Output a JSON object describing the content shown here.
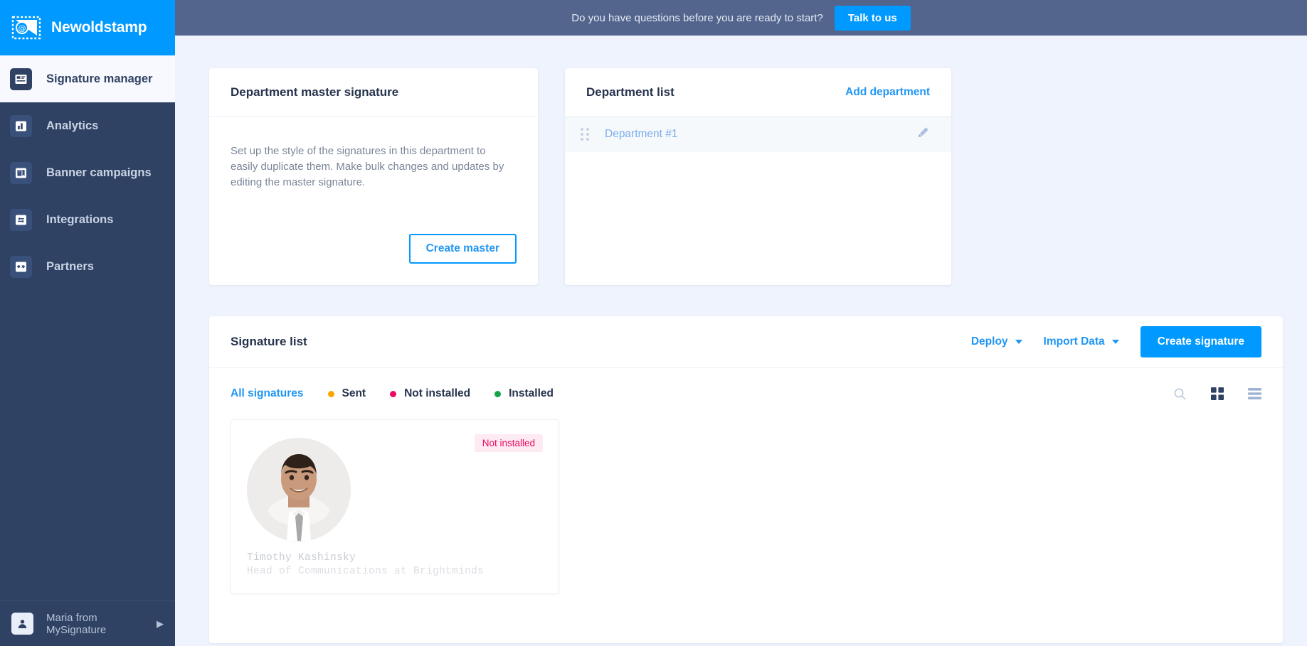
{
  "brand": {
    "name": "Newoldstamp",
    "logo_icon": "stamp-envelope-at-icon"
  },
  "sidebar": {
    "items": [
      {
        "label": "Signature manager",
        "icon": "id-card-icon",
        "active": true
      },
      {
        "label": "Analytics",
        "icon": "bar-chart-icon",
        "active": false
      },
      {
        "label": "Banner campaigns",
        "icon": "banner-icon",
        "active": false
      },
      {
        "label": "Integrations",
        "icon": "exchange-arrows-icon",
        "active": false
      },
      {
        "label": "Partners",
        "icon": "handshake-icon",
        "active": false
      }
    ],
    "chat": {
      "label": "Maria from MySignature",
      "avatar_icon": "person-icon",
      "arrow_icon": "chevron-right-icon"
    }
  },
  "topbar": {
    "message": "Do you have questions before you are ready to start?",
    "cta_label": "Talk to us"
  },
  "master_card": {
    "title": "Department master signature",
    "description": "Set up the style of the signatures in this department to easily duplicate them. Make bulk changes and updates by editing the master signature.",
    "button_label": "Create master"
  },
  "department_card": {
    "title": "Department list",
    "add_link": "Add department",
    "rows": [
      {
        "name": "Department #1",
        "drag_icon": "drag-handle-icon",
        "edit_icon": "pencil-icon"
      }
    ]
  },
  "signature_list": {
    "title": "Signature list",
    "deploy_label": "Deploy",
    "import_label": "Import Data",
    "create_label": "Create signature",
    "search_icon": "search-icon",
    "grid_view_icon": "grid-view-icon",
    "list_view_icon": "list-view-icon",
    "filters": [
      {
        "label": "All signatures",
        "dot": null
      },
      {
        "label": "Sent",
        "dot": "#ffa400"
      },
      {
        "label": "Not installed",
        "dot": "#ec0b63"
      },
      {
        "label": "Installed",
        "dot": "#15a54a"
      }
    ],
    "signatures": [
      {
        "name": "Timothy Kashinsky",
        "role": "Head of Communications at Brightminds",
        "status": "Not installed",
        "status_color": "#ec0b63",
        "status_bg": "#fdeaf2",
        "avatar_icon": "user-photo-avatar"
      }
    ]
  },
  "colors": {
    "accent": "#0099ff",
    "link": "#2196f3",
    "sidebar": "#2f4263",
    "topbar": "#53658d",
    "page_bg": "#eff3fd"
  }
}
